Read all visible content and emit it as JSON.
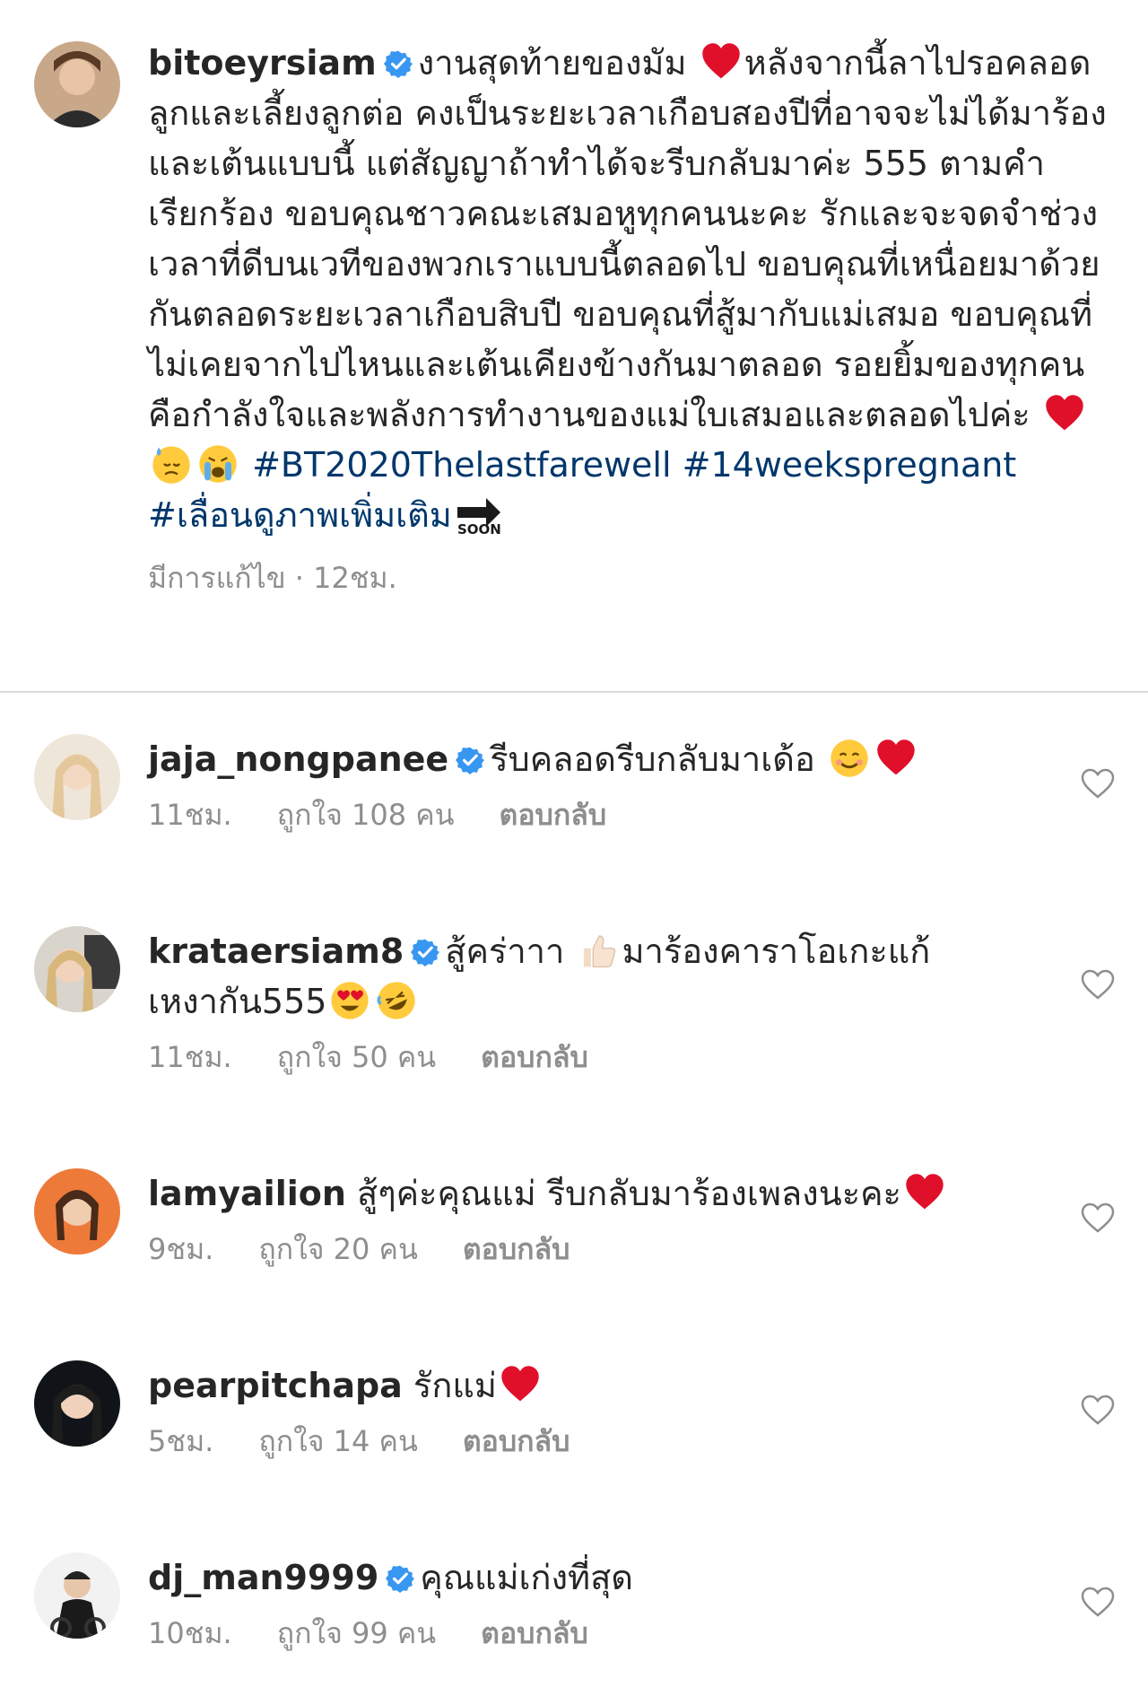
{
  "caption": {
    "username": "bitoeyrsiam",
    "text_part1": "งานสุดท้ายของมัม",
    "text_part2": "หลังจากนี้ลาไปรอคลอดลูกและเลี้ยงลูกต่อ คงเป็นระยะเวลาเกือบสองปีที่อาจจะไม่ได้มาร้องและเต้นแบบนี้ แต่สัญญาถ้าทำได้จะรีบกลับมาค่ะ 555 ตามคำเรียกร้อง ขอบคุณชาวคณะเสมอหูทุกคนนะคะ รักและจะจดจำช่วงเวลาที่ดีบนเวทีของพวกเราแบบนี้ตลอดไป ขอบคุณที่เหนื่อยมาด้วยกันตลอดระยะเวลาเกือบสิบปี ขอบคุณที่สู้มากับแม่เสมอ ขอบคุณที่ไม่เคยจากไปไหนและเต้นเคียงข้างกันมาตลอด รอยยิ้มของทุกคนคือกำลังใจและพลังการทำงานของแม่ใบเสมอและตลอดไปค่ะ",
    "hashtags": "#BT2020Thelastfarewell #14weekspregnant #เลื่อนดูภาพเพิ่มเติม",
    "soon_label": "SOON",
    "edited": "มีการแก้ไข",
    "time": "12ชม."
  },
  "comments": [
    {
      "username": "jaja_nongpanee",
      "text": "รีบคลอดรีบกลับมาเด้อ",
      "time": "11ชม.",
      "likes": "ถูกใจ 108 คน",
      "reply": "ตอบกลับ"
    },
    {
      "username": "krataersiam8",
      "text_a": "สู้คร่าาา",
      "text_b": "มาร้องคาราโอเกะแก้เหงากัน555",
      "time": "11ชม.",
      "likes": "ถูกใจ 50 คน",
      "reply": "ตอบกลับ"
    },
    {
      "username": "lamyailion",
      "text": "สู้ๆค่ะคุณแม่ รีบกลับมาร้องเพลงนะคะ",
      "time": "9ชม.",
      "likes": "ถูกใจ 20 คน",
      "reply": "ตอบกลับ"
    },
    {
      "username": "pearpitchapa",
      "text": "รักแม่",
      "time": "5ชม.",
      "likes": "ถูกใจ 14 คน",
      "reply": "ตอบกลับ"
    },
    {
      "username": "dj_man9999",
      "text": "คุณแม่เก่งที่สุด",
      "time": "10ชม.",
      "likes": "ถูกใจ 99 คน",
      "reply": "ตอบกลับ"
    }
  ],
  "colors": {
    "verified": "#3897f0",
    "hashtag": "#00376b",
    "heart": "#e0102a",
    "meta": "#8e8e8e"
  }
}
